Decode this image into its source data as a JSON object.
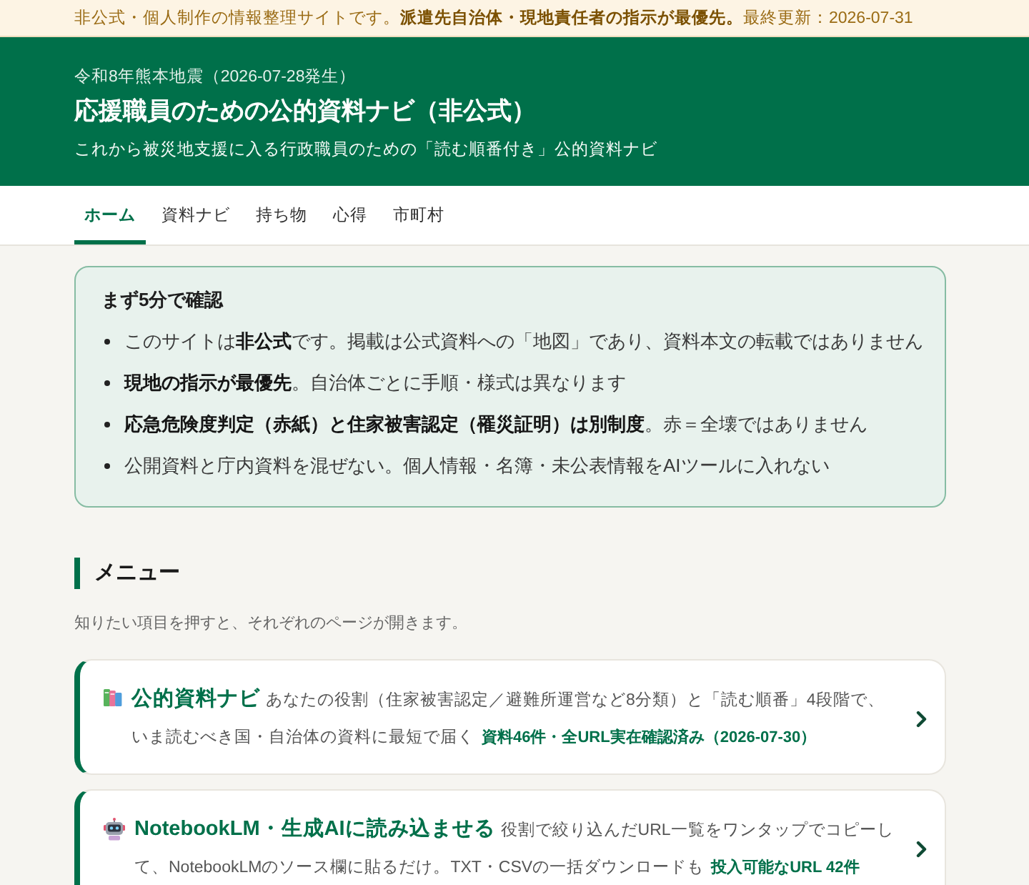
{
  "notice": {
    "text": "非公式・個人制作の情報整理サイトです。**派遣先自治体・現地責任者の指示が最優先。**最終更新：2026-07-31"
  },
  "header": {
    "subtitle": "令和8年熊本地震（2026-07-28発生）",
    "title": "応援職員のための公的資料ナビ（非公式）",
    "tagline": "これから被災地支援に入る行政職員のための「読む順番付き」公的資料ナビ"
  },
  "tabs": [
    {
      "label": "ホーム",
      "selected": true
    },
    {
      "label": "資料ナビ",
      "selected": false
    },
    {
      "label": "持ち物",
      "selected": false
    },
    {
      "label": "心得",
      "selected": false
    },
    {
      "label": "市町村",
      "selected": false
    }
  ],
  "quick_check": {
    "title": "まず5分で確認",
    "items": [
      "このサイトは**非公式**です。掲載は公式資料への「地図」であり、資料本文の転載ではありません",
      "**現地の指示が最優先**。自治体ごとに手順・様式は異なります",
      "**応急危険度判定（赤紙）と住家被害認定（罹災証明）は別制度**。赤＝全壊ではありません",
      "公開資料と庁内資料を混ぜない。個人情報・名簿・未公表情報をAIツールに入れない"
    ]
  },
  "menu": {
    "heading": "メニュー",
    "description": "知りたい項目を押すと、それぞれのページが開きます。",
    "cards": [
      {
        "title": "公的資料ナビ",
        "description": "あなたの役割（住家被害認定／避難所運営など8分類）と「読む順番」4段階で、いま読むべき国・自治体の資料に最短で届く",
        "meta": "資料46件・全URL実在確認済み（2026-07-30）"
      },
      {
        "title": "NotebookLM・生成AIに読み込ませる",
        "description": "役割で絞り込んだURL一覧をワンタップでコピーして、NotebookLMのソース欄に貼るだけ。TXT・CSVの一括ダウンロードも",
        "meta": "投入可能なURL 42件"
      }
    ]
  }
}
